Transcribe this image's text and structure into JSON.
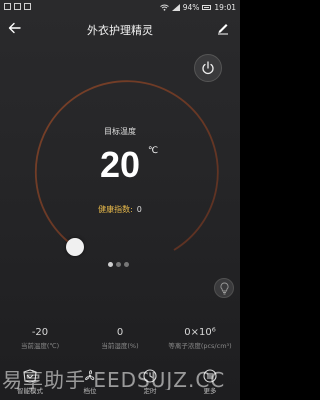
{
  "status_bar": {
    "battery": "94%",
    "time": "19:01"
  },
  "header": {
    "title": "外衣护理精灵"
  },
  "dial": {
    "target_label": "目标温度",
    "temperature": "20",
    "unit": "℃",
    "health_label": "健康指数:",
    "health_value": "0",
    "level": 0.0,
    "pages": 3,
    "active_page": 0
  },
  "readings": [
    {
      "value": "-20",
      "label": "当前温度(℃)"
    },
    {
      "value": "0",
      "label": "当前湿度(%)"
    },
    {
      "value": "0×10⁶",
      "label": "等离子浓度(pcs/cm³)"
    }
  ],
  "nav": [
    {
      "label": "智能模式",
      "icon": "smart-mode-icon"
    },
    {
      "label": "档位",
      "icon": "fan-icon"
    },
    {
      "label": "定时",
      "icon": "clock-icon"
    },
    {
      "label": "更多",
      "icon": "more-icon"
    }
  ],
  "watermark": "易享助手 EEDSUJZ.CC",
  "colors": {
    "background": "#262628",
    "dial_arc": "#6b3a26",
    "health_text": "#e6b84a",
    "knob": "#f0f0f0"
  }
}
